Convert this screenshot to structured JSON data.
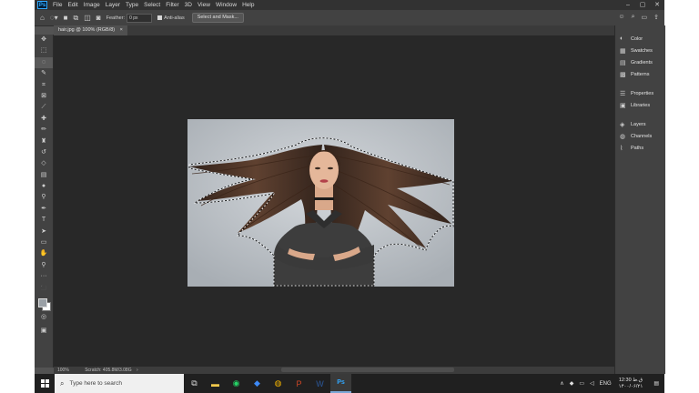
{
  "menubar": {
    "logo": "Ps",
    "items": [
      "File",
      "Edit",
      "Image",
      "Layer",
      "Type",
      "Select",
      "Filter",
      "3D",
      "View",
      "Window",
      "Help"
    ]
  },
  "options": {
    "feather_label": "Feather:",
    "feather_value": "0 px",
    "antialias_label": "Anti-alias",
    "select_mask_label": "Select and Mask..."
  },
  "document": {
    "tab_title": "hair.jpg @ 100% (RGB/8)",
    "zoom": "100%",
    "scratch": "Scratch: 405.8M/3.08G"
  },
  "panels": {
    "items": [
      "Color",
      "Swatches",
      "Gradients",
      "Patterns",
      "Properties",
      "Libraries",
      "Layers",
      "Channels",
      "Paths"
    ]
  },
  "taskbar": {
    "search_placeholder": "Type here to search",
    "language": "ENG",
    "time": "12:30 ق.ظ",
    "date": "۱۴۰۰/۰۶/۲۱"
  },
  "colors": {
    "app_bg": "#535353",
    "canvas_bg": "#282828",
    "accent": "#31a8ff"
  }
}
